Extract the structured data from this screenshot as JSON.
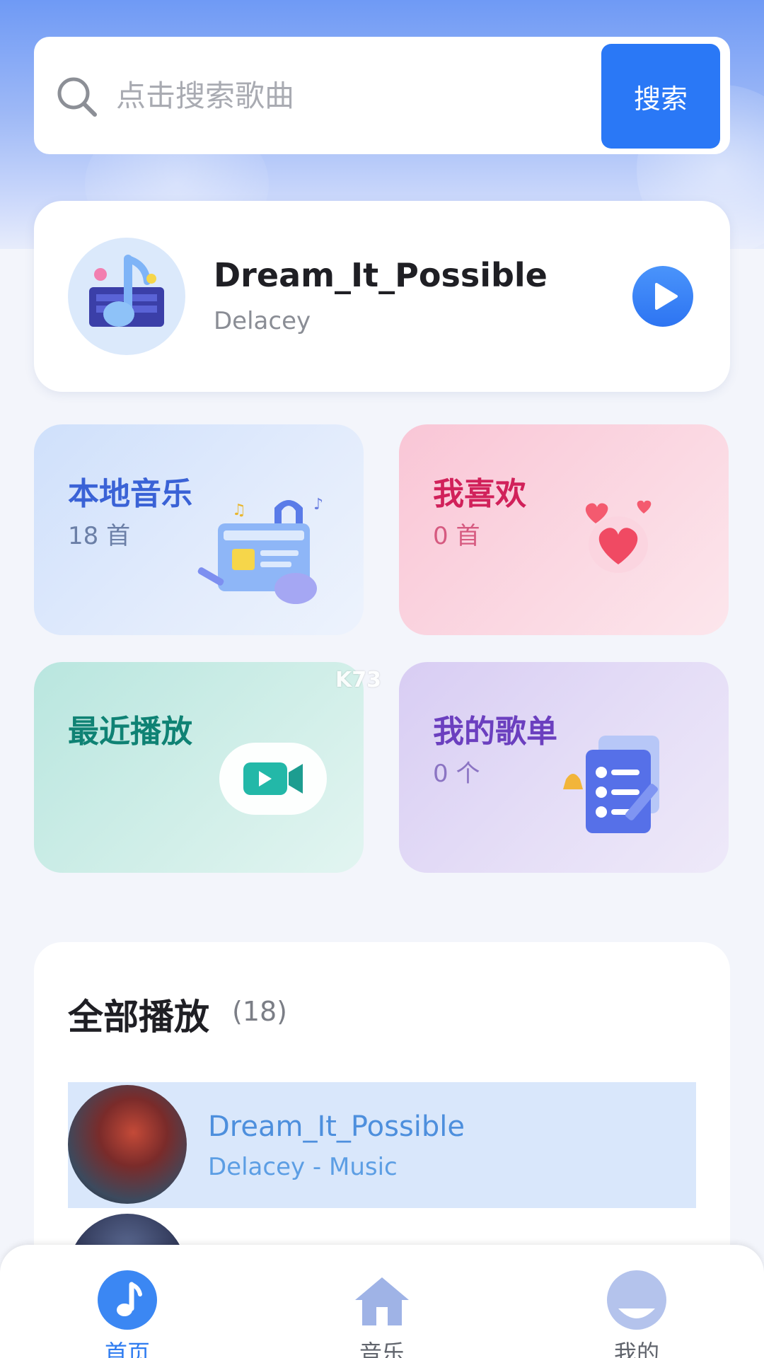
{
  "search": {
    "placeholder": "点击搜索歌曲",
    "button_label": "搜索"
  },
  "now_playing": {
    "title": "Dream_It_Possible",
    "artist": "Delacey"
  },
  "categories": [
    {
      "title": "本地音乐",
      "count": "18 首"
    },
    {
      "title": "我喜欢",
      "count": "0 首"
    },
    {
      "title": "最近播放",
      "count": ""
    },
    {
      "title": "我的歌单",
      "count": "0 个"
    }
  ],
  "all_play": {
    "title": "全部播放",
    "count": "(18)",
    "tracks": [
      {
        "title": "Dream_It_Possible",
        "subtitle": "Delacey - Music"
      }
    ]
  },
  "bottom_nav": {
    "items": [
      {
        "label": "首页",
        "icon": "music-note-icon"
      },
      {
        "label": "音乐",
        "icon": "home-icon"
      },
      {
        "label": "我的",
        "icon": "user-icon"
      }
    ]
  },
  "watermark": "K73",
  "colors": {
    "accent": "#2a78f6",
    "active_nav": "#2f7cf0",
    "highlight_row": "#d9e7fb"
  }
}
